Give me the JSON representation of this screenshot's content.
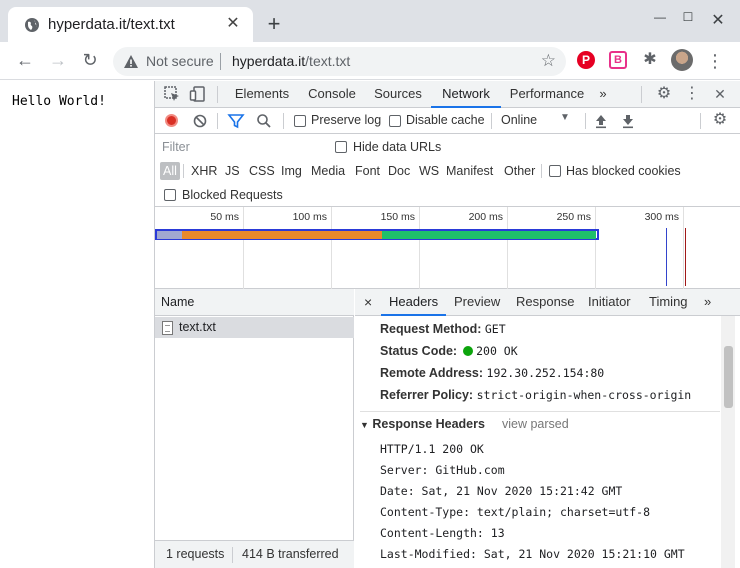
{
  "browser": {
    "tab_title": "hyperdata.it/text.txt",
    "new_tab": "+",
    "window": {
      "minimize": "—",
      "maximize": "☐",
      "close": "✕"
    },
    "omnibox": {
      "security_label": "Not secure",
      "host": "hyperdata.it",
      "path": "/text.txt"
    },
    "extensions": {
      "pinterest": "P",
      "b_ext": "B"
    }
  },
  "page": {
    "text": "Hello World!"
  },
  "devtools": {
    "tabs": [
      "Elements",
      "Console",
      "Sources",
      "Network",
      "Performance"
    ],
    "active_tab": "Network",
    "more": "»",
    "network_toolbar": {
      "preserve_log": "Preserve log",
      "disable_cache": "Disable cache",
      "throttling": "Online"
    },
    "filter": {
      "placeholder": "Filter",
      "hide_data_urls": "Hide data URLs",
      "types": [
        "All",
        "XHR",
        "JS",
        "CSS",
        "Img",
        "Media",
        "Font",
        "Doc",
        "WS",
        "Manifest",
        "Other"
      ],
      "has_blocked_cookies": "Has blocked cookies",
      "blocked_requests": "Blocked Requests"
    },
    "overview": {
      "ticks": [
        "50 ms",
        "100 ms",
        "150 ms",
        "200 ms",
        "250 ms",
        "300 ms"
      ],
      "colors": {
        "waiting": "#a0a8d0",
        "ttfb": "#e8892a",
        "download": "#1fbf6a",
        "outline": "#2a3ad8",
        "dom": "#3344cc",
        "load": "#a01818"
      }
    },
    "requests": {
      "column": "Name",
      "items": [
        {
          "name": "text.txt"
        }
      ],
      "footer_count": "1 requests",
      "footer_transferred": "414 B transferred"
    },
    "details": {
      "close": "×",
      "tabs": [
        "Headers",
        "Preview",
        "Response",
        "Initiator",
        "Timing"
      ],
      "active_tab": "Headers",
      "more": "»",
      "general": [
        {
          "key": "Request Method:",
          "value": "GET"
        },
        {
          "key": "Status Code:",
          "value": "200 OK"
        },
        {
          "key": "Remote Address:",
          "value": "192.30.252.154:80"
        },
        {
          "key": "Referrer Policy:",
          "value": "strict-origin-when-cross-origin"
        }
      ],
      "response_headers_title": "Response Headers",
      "view_parsed": "view parsed",
      "response_headers": [
        "HTTP/1.1 200 OK",
        "Server: GitHub.com",
        "Date: Sat, 21 Nov 2020 15:21:42 GMT",
        "Content-Type: text/plain; charset=utf-8",
        "Content-Length: 13",
        "Last-Modified: Sat, 21 Nov 2020 15:21:10 GMT"
      ]
    }
  }
}
